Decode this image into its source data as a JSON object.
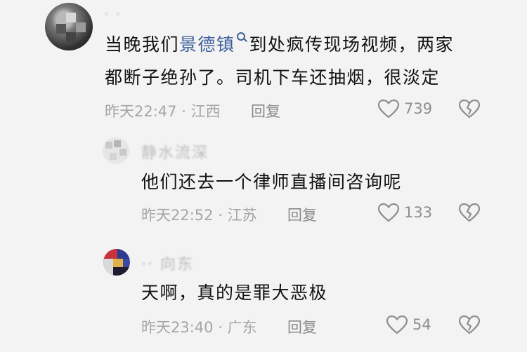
{
  "comments": [
    {
      "username": "·  ·",
      "text_line1_before": "当晚我们",
      "link": "景德镇",
      "text_line1_after": "到处疯传现场视频，两家",
      "text_line2": "都断子绝孙了。司机下车还抽烟，很淡定",
      "time": "昨天22:47",
      "dot": "·",
      "location": "江西",
      "reply_label": "回复",
      "likes": "739"
    },
    {
      "username": "静水流深",
      "text": "他们还去一个律师直播间咨询呢",
      "time": "昨天22:52",
      "dot": "·",
      "location": "江苏",
      "reply_label": "回复",
      "likes": "133"
    },
    {
      "username": "·· 向东",
      "text": "天啊，真的是罪大恶极",
      "time": "昨天23:40",
      "dot": "·",
      "location": "广东",
      "reply_label": "回复",
      "likes": "54"
    }
  ],
  "icons": {
    "like": "heart-outline-icon",
    "dislike": "broken-heart-icon",
    "search": "search-icon"
  },
  "colors": {
    "background": "#f3f3f3",
    "text": "#111111",
    "link": "#3d5f9b",
    "meta": "#a6a6a6"
  }
}
